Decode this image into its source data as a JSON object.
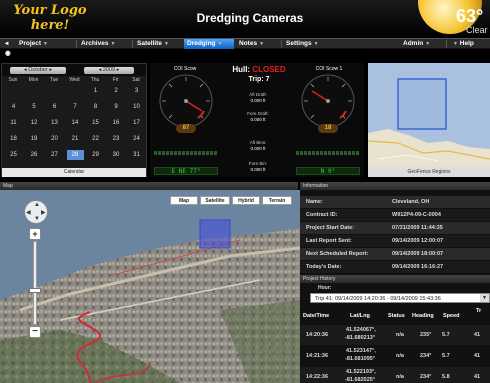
{
  "header": {
    "logo_line1": "Your Logo",
    "logo_line2": "here!",
    "title": "Dredging Cameras",
    "temperature": "63°",
    "condition": "Clear"
  },
  "menu": {
    "items": [
      {
        "label": "Project"
      },
      {
        "label": "Archives"
      },
      {
        "label": "Satellite"
      },
      {
        "label": "Dredging",
        "active": true
      },
      {
        "label": "Notes"
      },
      {
        "label": "Settings"
      },
      {
        "label": "Admin"
      },
      {
        "label": "Help"
      }
    ]
  },
  "calendar": {
    "month": "October",
    "year": "2009",
    "dow": [
      "Sun",
      "Mon",
      "Tue",
      "Wed",
      "Thu",
      "Fri",
      "Sat"
    ],
    "weeks": [
      [
        "",
        "",
        "",
        "",
        "1",
        "2",
        "3"
      ],
      [
        "4",
        "5",
        "6",
        "7",
        "8",
        "9",
        "10"
      ],
      [
        "11",
        "12",
        "13",
        "14",
        "15",
        "16",
        "17"
      ],
      [
        "18",
        "19",
        "20",
        "21",
        "22",
        "23",
        "24"
      ],
      [
        "25",
        "26",
        "27",
        "28",
        "29",
        "30",
        "31"
      ]
    ],
    "selected_day": "28",
    "footer": "Calendar"
  },
  "gauges": {
    "left_title": "COI Scow",
    "right_title": "COI Scow 1",
    "left_value": "87",
    "right_value": "18",
    "left_heading": "E NE 77°",
    "right_heading": "N 0°",
    "hull_label": "Hull:",
    "hull_status": "CLOSED",
    "trip": "Trip: 7",
    "aft_draft_label": "Aft Draft:",
    "aft_draft_value": "0.000 ft",
    "fore_draft_label": "Fore Draft:",
    "fore_draft_value": "0.000 ft",
    "aft_bin_label": "Aft Bins:",
    "aft_bin_value": "0.000 ft",
    "fore_bin_label": "Fore Bin:",
    "fore_bin_value": "0.000 ft"
  },
  "geofence": {
    "footer": "GeoFence Regions"
  },
  "map_section": {
    "title": "Map",
    "buttons": [
      "Map",
      "Satellite",
      "Hybrid",
      "Terrain"
    ]
  },
  "info_section": {
    "title": "Information",
    "rows": [
      {
        "key": "Name:",
        "value": "Cleveland, OH"
      },
      {
        "key": "Contract ID:",
        "value": "W912P4-09-C-0004"
      },
      {
        "key": "Project Start Date:",
        "value": "07/31/2009 11:44:35"
      },
      {
        "key": "Last Report Sent:",
        "value": "09/14/2009 12:00:07"
      },
      {
        "key": "Next Scheduled Report:",
        "value": "09/14/2009 18:00:07"
      },
      {
        "key": "Today's Date:",
        "value": "09/14/2009 16:16:27"
      }
    ]
  },
  "history": {
    "title": "Project History",
    "hour_label": "Hour:",
    "selected_trip": "Trip 41: 09/14/2009 14:20:36 - 09/14/2009 15:43:36",
    "columns": [
      "Date/Time",
      "Lat/Lng",
      "Status",
      "Heading",
      "Speed",
      "Tr"
    ],
    "rows": [
      {
        "time": "14:20:36",
        "lat": "41.524067°,",
        "lng": "-81.680213°",
        "status": "n/a",
        "heading": "235°",
        "speed": "5.7",
        "tr": "41"
      },
      {
        "time": "14:21:36",
        "lat": "41.523147°,",
        "lng": "-81.681095°",
        "status": "n/a",
        "heading": "234°",
        "speed": "5.7",
        "tr": "41"
      },
      {
        "time": "14:22:36",
        "lat": "41.522193°,",
        "lng": "-81.682025°",
        "status": "n/a",
        "heading": "234°",
        "speed": "5.8",
        "tr": "41"
      }
    ]
  }
}
